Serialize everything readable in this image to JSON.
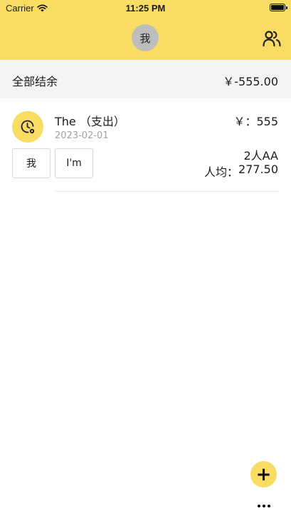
{
  "status_bar": {
    "carrier": "Carrier",
    "time": "11:25 PM"
  },
  "header": {
    "avatar_label": "我",
    "people_icon": "people-icon",
    "background_color": "#f8dc64"
  },
  "summary": {
    "label": "全部结余",
    "amount": "￥-555.00"
  },
  "transactions": [
    {
      "icon": "clock-icon",
      "title": "The （支出）",
      "date": "2023-02-01",
      "amount": "￥：555",
      "participants": [
        "我",
        "I'm"
      ],
      "split_type": "2人AA",
      "per_person_label": "人均：",
      "per_person_amount": "277.50"
    }
  ],
  "actions": {
    "add_icon": "plus-icon",
    "add_label": "+",
    "more_icon": "more-horizontal-icon"
  }
}
